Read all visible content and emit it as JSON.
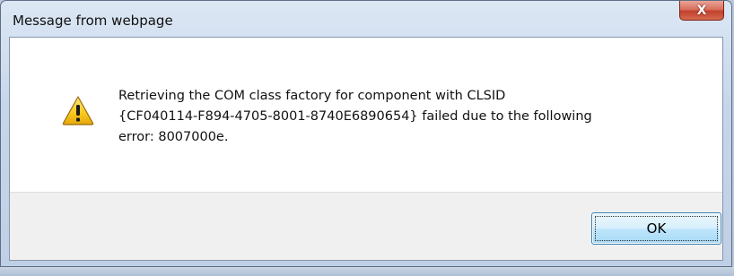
{
  "dialog": {
    "title": "Message from webpage",
    "close_label": "X",
    "message_lines": [
      "Retrieving the COM class factory for component with CLSID",
      "{CF040114-F894-4705-8001-8740E6890654} failed due to the following",
      "error: 8007000e."
    ],
    "icon": "warning-icon",
    "ok_label": "OK"
  },
  "colors": {
    "titlebar": "#c6d6ea",
    "close_button": "#c2402c",
    "button_area": "#f0f0f0",
    "ok_button_border": "#3c7fb1",
    "warning_yellow": "#f7c81e"
  }
}
